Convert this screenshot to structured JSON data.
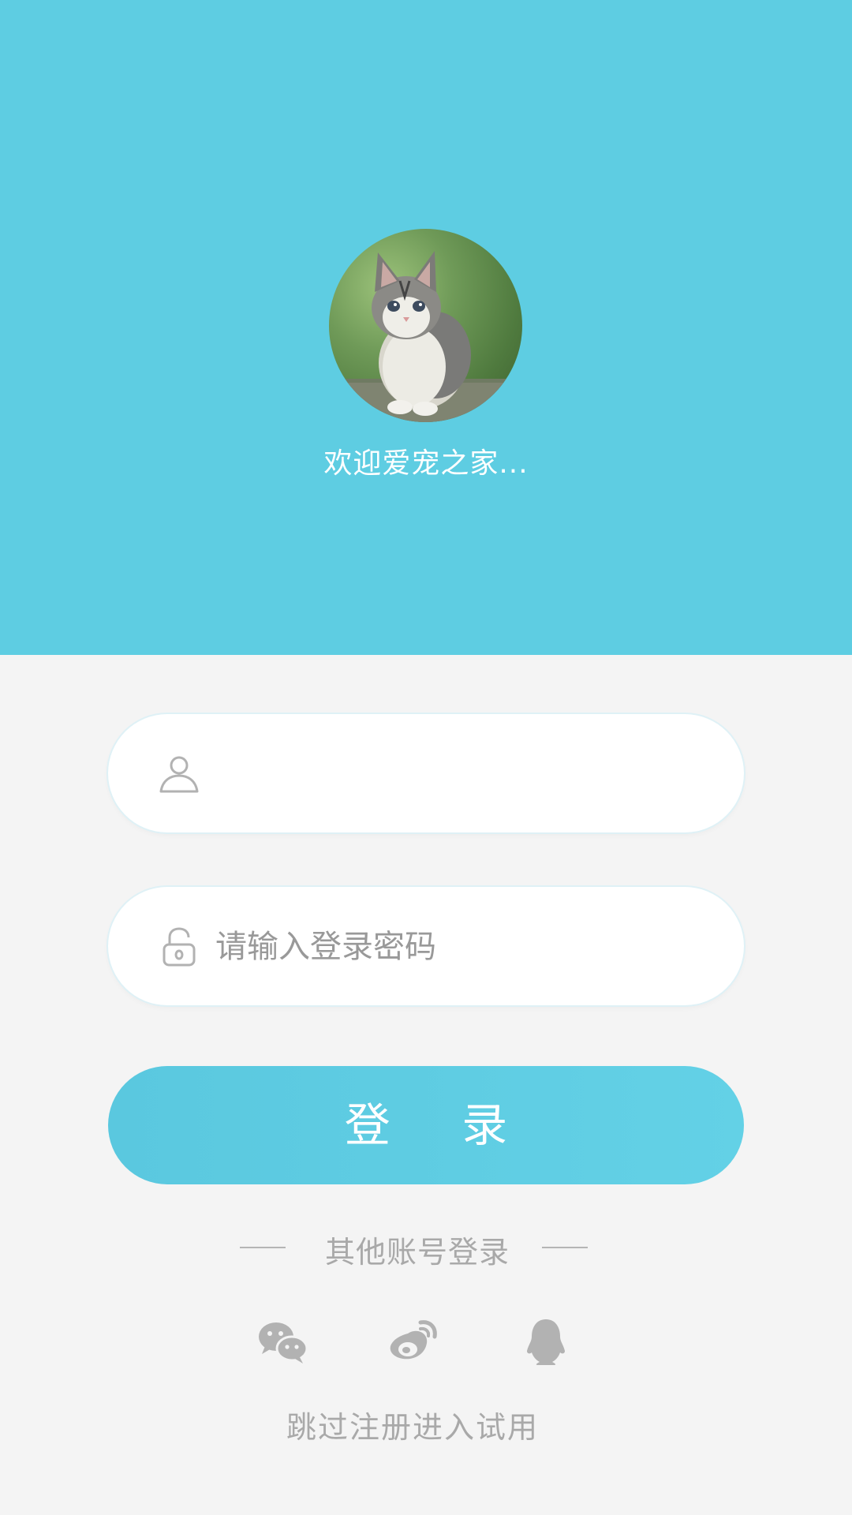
{
  "header": {
    "welcome_text": "欢迎爱宠之家...",
    "background_color": "#5ecde2"
  },
  "form": {
    "username": {
      "value": "",
      "placeholder": "",
      "icon": "user-icon"
    },
    "password": {
      "value": "",
      "placeholder": "请输入登录密码",
      "icon": "lock-icon"
    },
    "login_label": "登 录"
  },
  "other_login": {
    "label": "其他账号登录",
    "providers": [
      {
        "name": "wechat-icon"
      },
      {
        "name": "weibo-icon"
      },
      {
        "name": "qq-icon"
      }
    ]
  },
  "skip_label": "跳过注册进入试用",
  "colors": {
    "accent": "#5ecde2",
    "muted_text": "#a9a9a9",
    "icon_gray": "#b2b2b2",
    "page_bg": "#f4f4f4"
  }
}
